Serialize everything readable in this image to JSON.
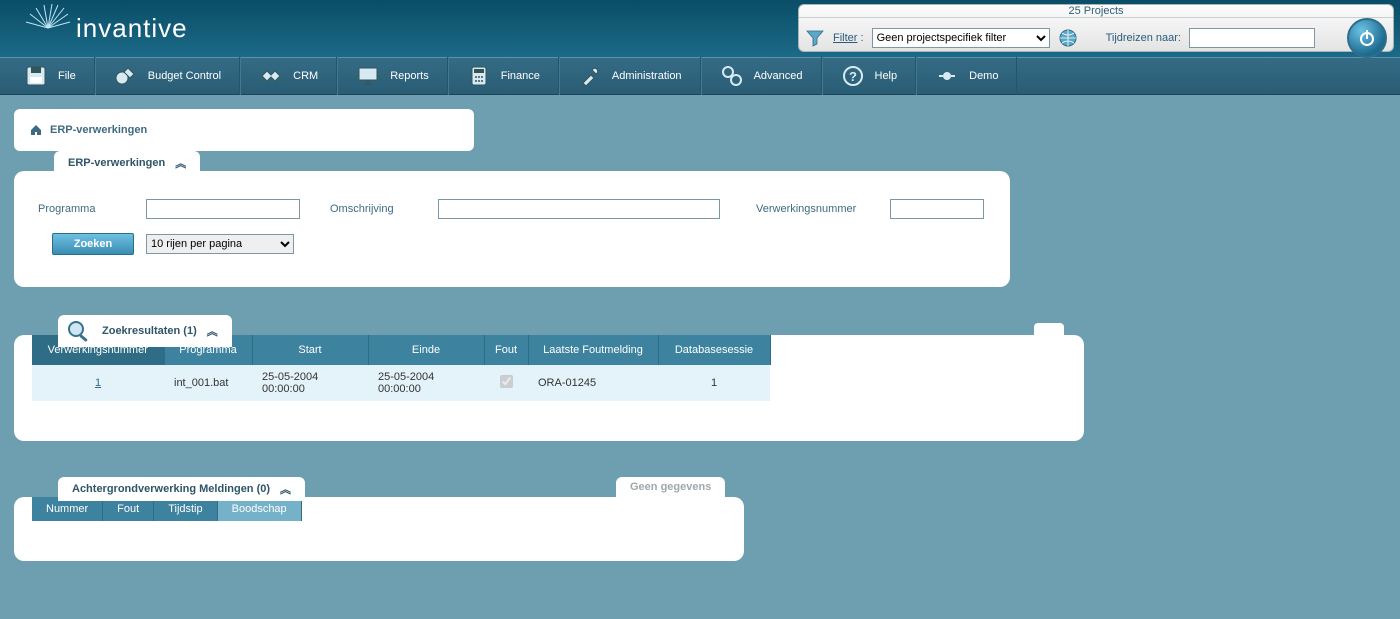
{
  "header": {
    "logo_text": "invantive",
    "projects_count": "25 Projects",
    "filter_label_prefix": "Filter",
    "filter_colon": " :",
    "filter_selected": "Geen projectspecifiek filter",
    "time_label": "Tijdreizen naar:",
    "time_value": ""
  },
  "menu": [
    {
      "label": "File"
    },
    {
      "label": "Budget Control"
    },
    {
      "label": "CRM"
    },
    {
      "label": "Reports"
    },
    {
      "label": "Finance"
    },
    {
      "label": "Administration"
    },
    {
      "label": "Advanced"
    },
    {
      "label": "Help"
    },
    {
      "label": "Demo"
    }
  ],
  "breadcrumb": {
    "title": "ERP-verwerkingen"
  },
  "search_panel": {
    "tab_title": "ERP-verwerkingen",
    "fields": {
      "programma_label": "Programma",
      "programma_value": "",
      "omschrijving_label": "Omschrijving",
      "omschrijving_value": "",
      "verwerkingsnummer_label": "Verwerkingsnummer",
      "verwerkingsnummer_value": ""
    },
    "zoeken_label": "Zoeken",
    "rows_selected": "10 rijen per pagina"
  },
  "results_panel": {
    "tab_title": "Zoekresultaten (1)",
    "columns": [
      "Verwerkingsnummer",
      "Programma",
      "Start",
      "Einde",
      "Fout",
      "Laatste Foutmelding",
      "Databasesessie"
    ],
    "rows": [
      {
        "verwerkingsnummer": "1",
        "programma": "int_001.bat",
        "start": "25-05-2004 00:00:00",
        "einde": "25-05-2004 00:00:00",
        "fout": true,
        "laatste_foutmelding": "ORA-01245",
        "databasesessie": "1"
      }
    ]
  },
  "messages_panel": {
    "tab_title": "Achtergrondverwerking Meldingen (0)",
    "no_data_label": "Geen gegevens",
    "columns": [
      "Nummer",
      "Fout",
      "Tijdstip",
      "Boodschap"
    ]
  }
}
